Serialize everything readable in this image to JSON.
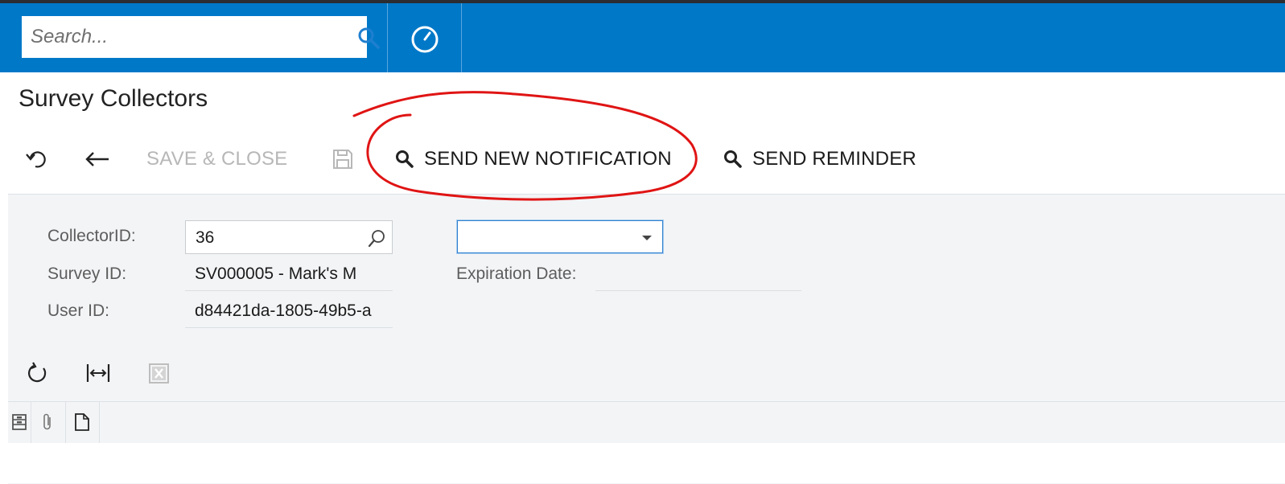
{
  "header": {
    "search_placeholder": "Search...",
    "brand_color": "#0078c8"
  },
  "page": {
    "title": "Survey Collectors"
  },
  "toolbar": {
    "save_close_label": "SAVE & CLOSE",
    "send_new_notification_label": "SEND NEW NOTIFICATION",
    "send_reminder_label": "SEND REMINDER"
  },
  "form": {
    "collector_id_label": "CollectorID:",
    "collector_id_value": "36",
    "survey_id_label": "Survey ID:",
    "survey_id_value": "SV000005 - Mark's M",
    "user_id_label": "User ID:",
    "user_id_value": "d84421da-1805-49b5-a",
    "dropdown_value": "",
    "expiration_date_label": "Expiration Date:",
    "expiration_date_value": ""
  },
  "colors": {
    "annotation_circle": "#e01414",
    "panel_bg": "#f3f4f6",
    "disabled_text": "#b7b7b7"
  },
  "icons": [
    "search-icon",
    "history-icon",
    "undo-icon",
    "back-arrow-icon",
    "save-icon",
    "magnifier-icon",
    "refresh-icon",
    "fit-columns-icon",
    "excel-export-icon",
    "files-icon",
    "attachment-icon",
    "note-icon"
  ]
}
